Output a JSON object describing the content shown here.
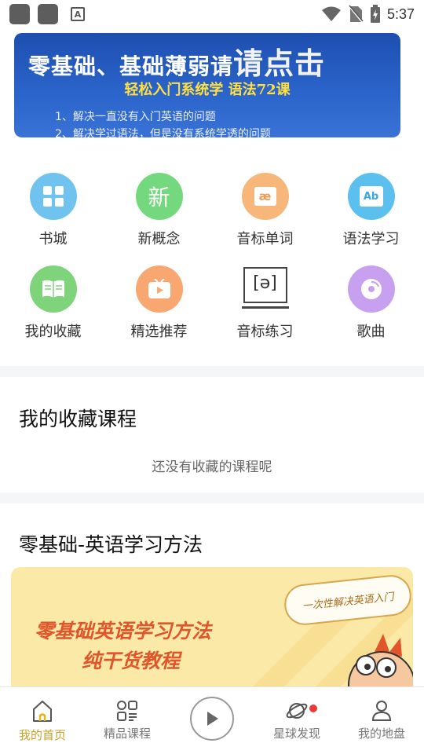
{
  "status_bar": {
    "time": "5:37"
  },
  "banner": {
    "title": "零基础、基础薄弱请",
    "title_big": "请点击",
    "subtitle": "轻松入门系统学  语法72课",
    "line1": "1、解决一直没有入门英语的问题",
    "line2": "2、解决学过语法，但是没有系统学透的问题",
    "dots": 2,
    "active_dot": 0
  },
  "grid": [
    {
      "label": "书城",
      "icon": "grid-apps-icon",
      "color": "#6fc3ee"
    },
    {
      "label": "新概念",
      "icon": "xin-text-icon",
      "glyph": "新",
      "color": "#74d97e"
    },
    {
      "label": "音标单词",
      "icon": "ae-phonetic-icon",
      "glyph": "æ",
      "color": "#f7b77a"
    },
    {
      "label": "语法学习",
      "icon": "ab-text-icon",
      "glyph": "Ab",
      "color": "#5cc0ee"
    },
    {
      "label": "我的收藏",
      "icon": "book-icon",
      "color": "#7fd37a"
    },
    {
      "label": "精选推荐",
      "icon": "video-play-icon",
      "color": "#f8a770"
    },
    {
      "label": "音标练习",
      "icon": "phonetic-board-icon",
      "glyph": "[ə]",
      "color": "#444444"
    },
    {
      "label": "歌曲",
      "icon": "music-disc-icon",
      "color": "#c8a0f0"
    }
  ],
  "favorites": {
    "title": "我的收藏课程",
    "empty_text": "还没有收藏的课程呢"
  },
  "course_section": {
    "title": "零基础-英语学习方法",
    "card_line1": "零基础英语学习方法",
    "card_line2": "纯干货教程",
    "card_bubble": "一次性解决英语入门"
  },
  "bottom_nav": [
    {
      "label": "我的首页",
      "icon": "home-icon",
      "active": true
    },
    {
      "label": "精品课程",
      "icon": "course-grid-icon",
      "active": false
    },
    {
      "label": "",
      "icon": "play-icon",
      "active": false
    },
    {
      "label": "星球发现",
      "icon": "planet-icon",
      "active": false,
      "badge": true
    },
    {
      "label": "我的地盘",
      "icon": "user-icon",
      "active": false
    }
  ],
  "colors": {
    "accent": "#c9a227",
    "banner_bg": "#2a63c9",
    "card_bg": "#fbe9a8",
    "card_text": "#e0552a"
  }
}
